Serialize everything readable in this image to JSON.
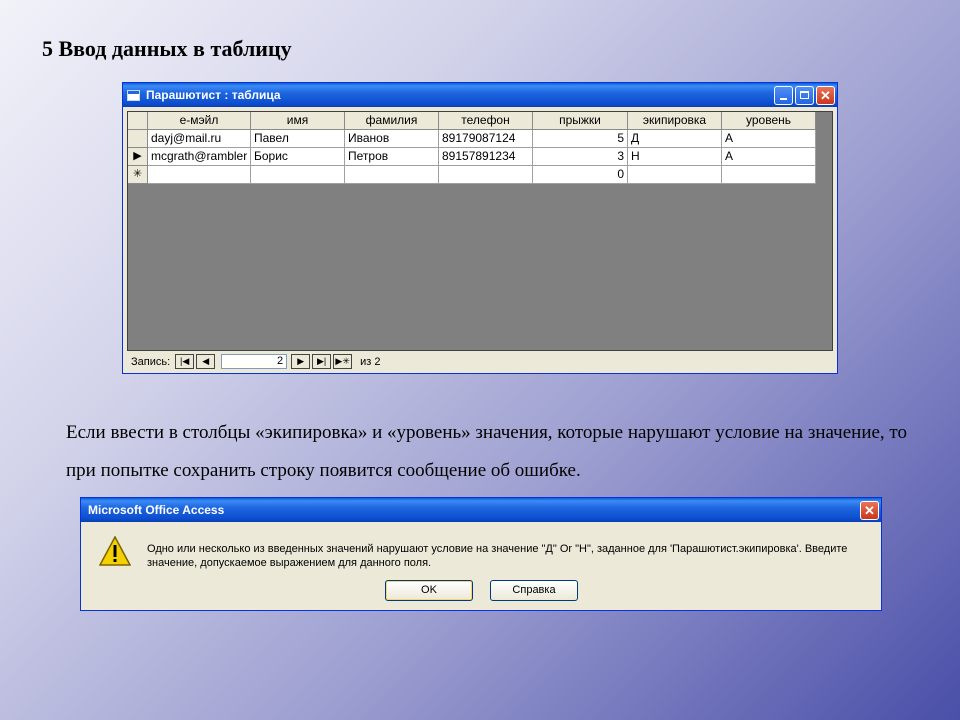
{
  "slide": {
    "title": "5 Ввод данных в таблицу",
    "text": "Если ввести в столбцы «экипировка» и «уровень» значения, которые нарушают условие на значение, то при попытке сохранить строку появится сообщение об ошибке."
  },
  "table_window": {
    "title": "Парашютист : таблица",
    "columns": [
      "е-мэйл",
      "имя",
      "фамилия",
      "телефон",
      "прыжки",
      "экипировка",
      "уровень"
    ],
    "rows": [
      {
        "selector": "",
        "email": "dayj@mail.ru",
        "name": "Павел",
        "surname": "Иванов",
        "phone": "89179087124",
        "jumps": "5",
        "gear": "Д",
        "level": "А"
      },
      {
        "selector": "▶",
        "email": "mcgrath@rambler",
        "name": "Борис",
        "surname": "Петров",
        "phone": "89157891234",
        "jumps": "3",
        "gear": "Н",
        "level": "А"
      },
      {
        "selector": "✳",
        "email": "",
        "name": "",
        "surname": "",
        "phone": "",
        "jumps": "0",
        "gear": "",
        "level": ""
      }
    ],
    "navigation": {
      "record_label": "Запись:",
      "first_glyph": "|◀",
      "prev_glyph": "◀",
      "current": "2",
      "next_glyph": "▶",
      "last_glyph": "▶|",
      "new_glyph": "▶✳",
      "of_total": "из 2"
    }
  },
  "error_dialog": {
    "title": "Microsoft Office Access",
    "icon": "warning-icon",
    "message": "Одно или несколько из введенных значений нарушают условие на значение  \"Д\" Or \"Н\", заданное для 'Парашютист.экипировка'.  Введите значение, допускаемое выражением для данного поля.",
    "ok_label": "OK",
    "help_label": "Справка"
  },
  "colors": {
    "xp_title_blue": "#0c4fcf",
    "xp_face": "#ece9d8",
    "datasheet_background": "#808080",
    "close_red": "#c8371a"
  }
}
